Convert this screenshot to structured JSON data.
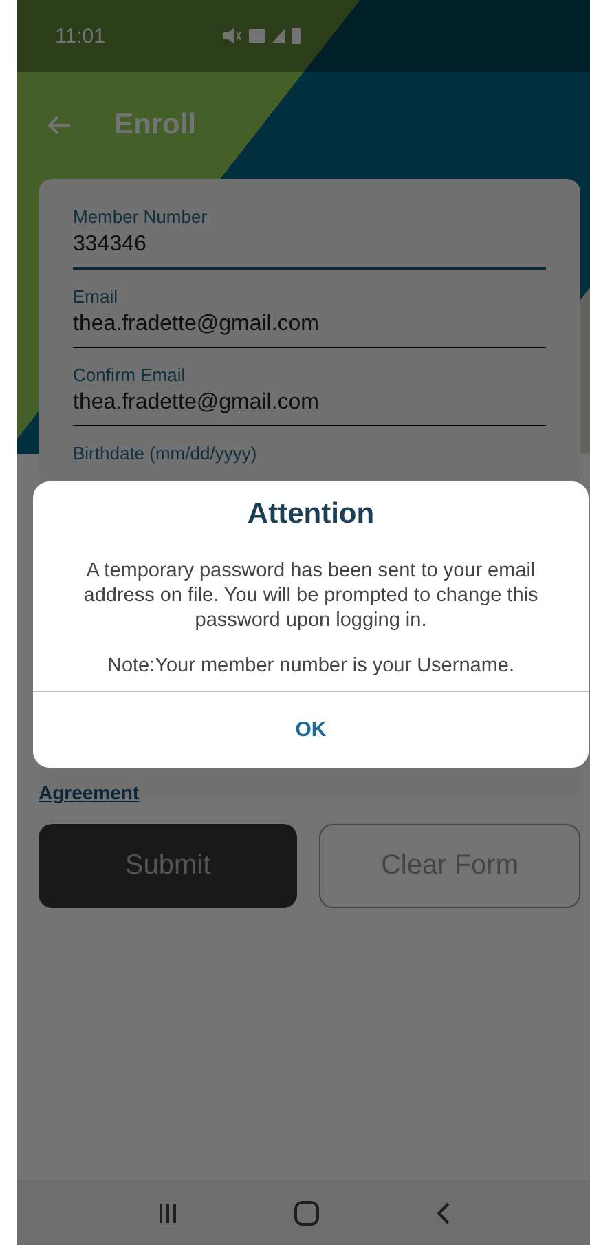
{
  "status_bar": {
    "time": "11:01"
  },
  "app_bar": {
    "title": "Enroll"
  },
  "form": {
    "fields": [
      {
        "label": "Member Number",
        "value": "334346",
        "focused": true
      },
      {
        "label": "Email",
        "value": "thea.fradette@gmail.com",
        "focused": false
      },
      {
        "label": "Confirm Email",
        "value": "thea.fradette@gmail.com",
        "focused": false
      },
      {
        "label": "Birthdate (mm/dd/yyyy)",
        "focused": false
      }
    ],
    "agreement_link": "Agreement"
  },
  "buttons": [
    {
      "label": "Submit",
      "kind": "primary"
    },
    {
      "label": "Clear Form",
      "kind": "outline"
    }
  ],
  "dialog": {
    "title": "Attention",
    "message": "A temporary password has been sent to your email address on file. You will be prompted to change this password upon logging in.",
    "note": "Note:Your member number is your Username.",
    "button": "OK"
  }
}
